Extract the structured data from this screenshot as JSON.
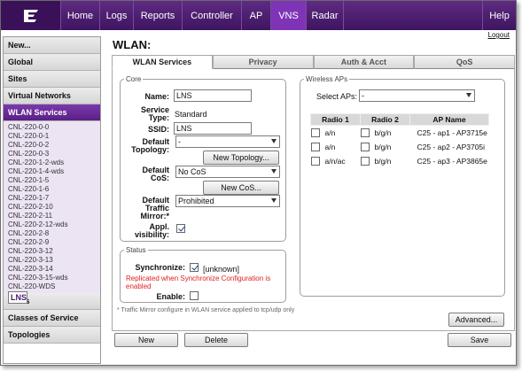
{
  "nav": {
    "tabs": [
      {
        "label": "Home"
      },
      {
        "label": "Logs"
      },
      {
        "label": "Reports"
      },
      {
        "label": "Controller"
      },
      {
        "label": "AP"
      },
      {
        "label": "VNS"
      },
      {
        "label": "Radar"
      }
    ],
    "help": "Help",
    "logout": "Logout",
    "active_color": "#7f34b8"
  },
  "sidebar": {
    "new": "New...",
    "global": "Global",
    "sites": "Sites",
    "virtual_networks": "Virtual Networks",
    "wlan_services": "WLAN Services",
    "items": [
      "CNL-220-0-0",
      "CNL-220-0-1",
      "CNL-220-0-2",
      "CNL-220-0-3",
      "CNL-220-1-2-wds",
      "CNL-220-1-4-wds",
      "CNL-220-1-5",
      "CNL-220-1-6",
      "CNL-220-1-7",
      "CNL-220-2-10",
      "CNL-220-2-11",
      "CNL-220-2-12-wds",
      "CNL-220-2-8",
      "CNL-220-2-9",
      "CNL-220-3-12",
      "CNL-220-3-13",
      "CNL-220-3-14",
      "CNL-220-3-15-wds",
      "CNL-220-WDS",
      "LNS"
    ],
    "roles": "Roles",
    "classes_of_service": "Classes of Service",
    "topologies": "Topologies"
  },
  "page": {
    "title": "WLAN:"
  },
  "tabs": [
    "WLAN Services",
    "Privacy",
    "Auth & Acct",
    "QoS"
  ],
  "core": {
    "legend": "Core",
    "name_label": "Name:",
    "name_value": "LNS",
    "service_type_label": "Service Type:",
    "service_type_value": "Standard",
    "ssid_label": "SSID:",
    "ssid_value": "LNS",
    "default_topology_label": "Default Topology:",
    "default_topology_value": "-",
    "new_topology_button": "New Topology...",
    "default_cos_label": "Default CoS:",
    "default_cos_value": "No CoS",
    "new_cos_button": "New CoS...",
    "traffic_mirror_label": "Default Traffic Mirror:*",
    "traffic_mirror_value": "Prohibited",
    "appl_visibility_label": "Appl. visibility:",
    "appl_visibility_checked": true
  },
  "status": {
    "legend": "Status",
    "synchronize_label": "Synchronize:",
    "synchronize_checked": true,
    "synchronize_value": "[unknown]",
    "replicated_note": "Replicated when Synchronize Configuration is enabled",
    "enable_label": "Enable:",
    "enable_checked": false
  },
  "wireless_aps": {
    "legend": "Wireless APs",
    "select_aps_label": "Select APs:",
    "select_aps_value": "-",
    "columns": [
      "Radio 1",
      "Radio 2",
      "AP Name"
    ],
    "rows": [
      {
        "radio1": "a/n",
        "radio2": "b/g/n",
        "ap_name": "C25 - ap1 - AP3715e"
      },
      {
        "radio1": "a/n",
        "radio2": "b/g/n",
        "ap_name": "C25 - ap2 - AP3705i"
      },
      {
        "radio1": "a/n/ac",
        "radio2": "b/g/n",
        "ap_name": "C25 - ap3 - AP3865e"
      }
    ]
  },
  "footnote": "* Traffic Mirror configure in WLAN service applied to tcp/udp only",
  "buttons": {
    "advanced": "Advanced...",
    "new": "New",
    "delete": "Delete",
    "save": "Save"
  }
}
